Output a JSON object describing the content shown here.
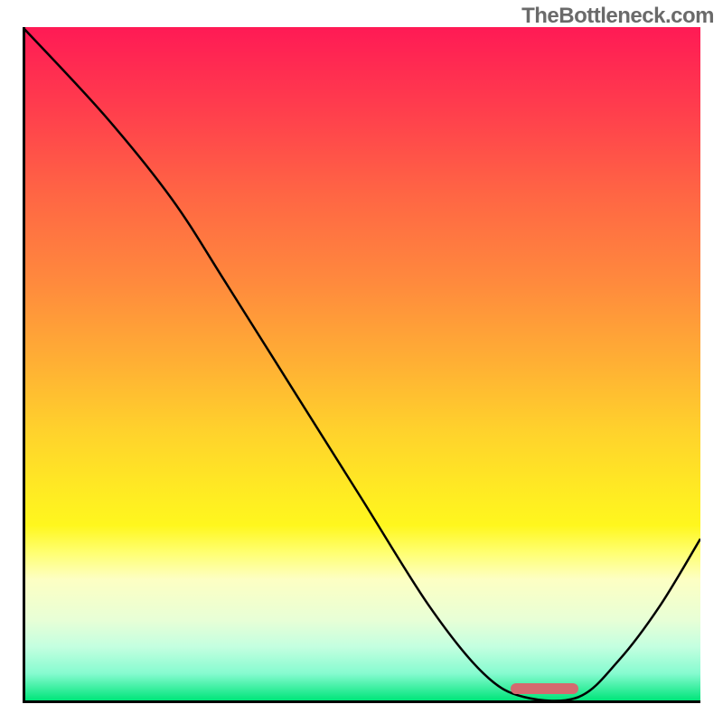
{
  "attribution": "TheBottleneck.com",
  "chart_data": {
    "type": "line",
    "title": "",
    "xlabel": "",
    "ylabel": "",
    "xlim": [
      0,
      100
    ],
    "ylim": [
      0,
      100
    ],
    "grid": false,
    "curve_points": [
      {
        "x": 0.0,
        "y": 100.0
      },
      {
        "x": 12.0,
        "y": 87.0
      },
      {
        "x": 22.0,
        "y": 74.5
      },
      {
        "x": 30.0,
        "y": 62.0
      },
      {
        "x": 40.0,
        "y": 46.0
      },
      {
        "x": 50.0,
        "y": 30.0
      },
      {
        "x": 60.0,
        "y": 14.0
      },
      {
        "x": 68.0,
        "y": 4.0
      },
      {
        "x": 74.0,
        "y": 0.5
      },
      {
        "x": 82.0,
        "y": 0.5
      },
      {
        "x": 88.0,
        "y": 6.0
      },
      {
        "x": 94.0,
        "y": 14.0
      },
      {
        "x": 100.0,
        "y": 24.0
      }
    ],
    "optimum_band": {
      "x_start": 72.0,
      "x_end": 82.0,
      "y": 1.8
    },
    "colors": {
      "top": "#ff1a55",
      "mid": "#fff200",
      "bottom": "#00e57a",
      "bar": "#d46a6f"
    }
  }
}
